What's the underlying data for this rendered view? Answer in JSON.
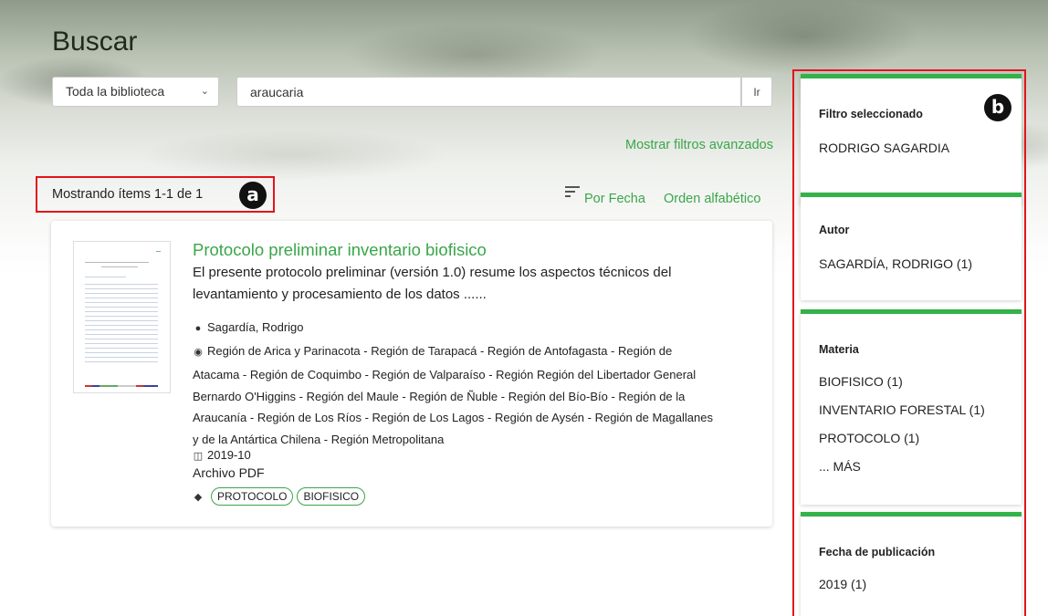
{
  "page": {
    "title": "Buscar"
  },
  "search": {
    "scope": "Toda la biblioteca",
    "query": "araucaria",
    "go_label": "Ir",
    "advanced_label": "Mostrar filtros avanzados"
  },
  "results": {
    "count_text": "Mostrando ítems 1-1 de 1",
    "sort_date": "Por Fecha",
    "sort_alpha": "Orden alfabético",
    "items": [
      {
        "title": "Protocolo preliminar inventario biofisico",
        "abstract": "El presente protocolo preliminar (versión 1.0) resume los aspectos técnicos del levantamiento y procesamiento de los datos ......",
        "author": "Sagardía, Rodrigo",
        "places": "Región de Arica y Parinacota - Región de Tarapacá - Región de Antofagasta - Región de Atacama - Región de Coquimbo - Región de Valparaíso - Región Región del Libertador General Bernardo O'Higgins - Región del Maule - Región de Ñuble - Región del Bío-Bío - Región de la Araucanía - Región de Los Ríos - Región de Los Lagos - Región de Aysén - Región de Magallanes y de la Antártica Chilena - Región Metropolitana",
        "date": "2019-10",
        "format": "Archivo PDF",
        "tags": [
          "PROTOCOLO",
          "BIOFISICO"
        ]
      }
    ]
  },
  "facets": {
    "selected": {
      "heading": "Filtro seleccionado",
      "value": "RODRIGO SAGARDIA"
    },
    "author": {
      "heading": "Autor",
      "items": [
        "SAGARDÍA, RODRIGO (1)"
      ]
    },
    "subject": {
      "heading": "Materia",
      "items": [
        "BIOFISICO (1)",
        "INVENTARIO FORESTAL (1)",
        "PROTOCOLO (1)",
        "... MÁS"
      ]
    },
    "pubdate": {
      "heading": "Fecha de publicación",
      "items": [
        "2019 (1)"
      ]
    }
  },
  "annotations": {
    "a": "a",
    "b": "b"
  },
  "colors": {
    "accent": "#3aa64a",
    "highlight": "#e3141b",
    "facet_bar": "#34b24a"
  },
  "icons": {
    "author": "person-icon",
    "place": "map-pin-icon",
    "date": "calendar-icon",
    "tags": "tag-icon",
    "sort": "sort-icon",
    "dropdown": "chevron-down-icon"
  }
}
